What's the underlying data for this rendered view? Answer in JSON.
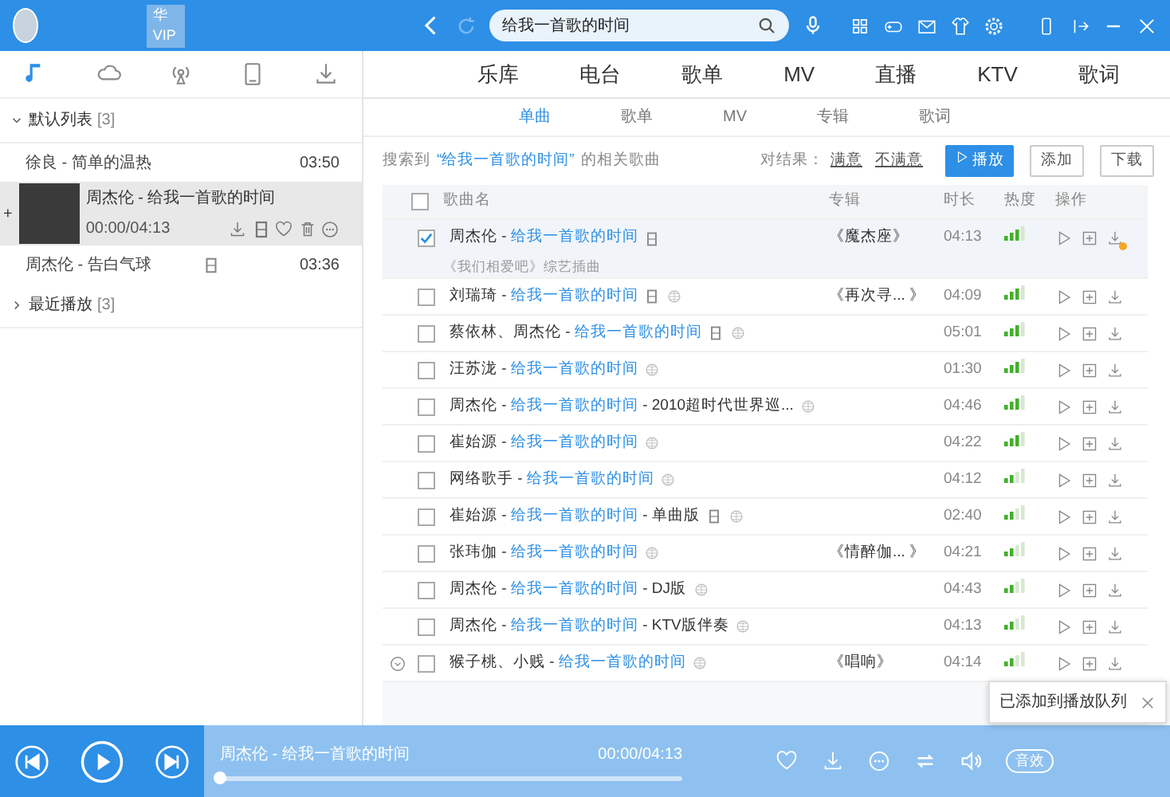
{
  "top_bar": {
    "username": "华VIP",
    "search": {
      "value": "给我一首歌的时间"
    }
  },
  "sidebar": {
    "tabs": [
      {
        "selected": true
      },
      {
        "selected": false
      },
      {
        "selected": false
      },
      {
        "selected": false
      },
      {
        "selected": false
      }
    ],
    "groups": [
      {
        "title": "默认列表",
        "count": "[3]",
        "expanded": true,
        "items": [
          {
            "kind": "song",
            "title": "徐良 - 简单的温热",
            "duration": "03:50",
            "mv": false
          },
          {
            "kind": "playing",
            "title": "周杰伦 - 给我一首歌的时间",
            "time": "00:00/04:13",
            "plus": "+"
          },
          {
            "kind": "song",
            "title": "周杰伦 - 告白气球",
            "duration": "03:36",
            "mv": true
          }
        ]
      },
      {
        "title": "最近播放",
        "count": "[3]",
        "expanded": false
      }
    ]
  },
  "nav_tabs": [
    {
      "label": "乐库",
      "selected": false
    },
    {
      "label": "电台",
      "selected": false
    },
    {
      "label": "歌单",
      "selected": false
    },
    {
      "label": "MV",
      "selected": false
    },
    {
      "label": "直播",
      "selected": false
    },
    {
      "label": "KTV",
      "selected": false
    },
    {
      "label": "歌词",
      "selected": false
    }
  ],
  "sub_tabs": [
    {
      "label": "单曲",
      "selected": true
    },
    {
      "label": "歌单",
      "selected": false
    },
    {
      "label": "MV",
      "selected": false
    },
    {
      "label": "专辑",
      "selected": false
    },
    {
      "label": "歌词",
      "selected": false
    }
  ],
  "result_bar": {
    "prefix": "搜索到",
    "query": "“给我一首歌的时间”",
    "suffix": "的相关歌曲",
    "feedback_label": "对结果：",
    "satisfied": "满意",
    "unsatisfied": "不满意",
    "buttons": [
      {
        "kind": "primary",
        "label": "播放"
      },
      {
        "kind": "plain",
        "label": "添加"
      },
      {
        "kind": "plain",
        "label": "下载"
      }
    ]
  },
  "table": {
    "columns": [
      "歌曲名",
      "专辑",
      "时长",
      "热度",
      "操作"
    ],
    "all_checked": false,
    "rows": [
      {
        "name": "周杰伦 - *给我一首歌的时间*",
        "note": "《我们相爱吧》综艺插曲",
        "album": "《魔杰座》",
        "duration": "04:13",
        "level": 0.75,
        "checked": true,
        "mv": true,
        "sq": false,
        "expandable": false,
        "download_badge": true
      },
      {
        "name": "刘瑞琦 - *给我一首歌的时间*",
        "album": "《再次寻... 》",
        "duration": "04:09",
        "level": 0.75,
        "checked": false,
        "mv": true,
        "sq": true,
        "expandable": false,
        "download_badge": false
      },
      {
        "name": "蔡依林、周杰伦 - *给我一首歌的时间*",
        "duration": "05:01",
        "level": 0.75,
        "checked": false,
        "mv": true,
        "sq": true,
        "expandable": false,
        "download_badge": false
      },
      {
        "name": "汪苏泷 - *给我一首歌的时间*",
        "duration": "01:30",
        "level": 0.75,
        "checked": false,
        "mv": false,
        "sq": true,
        "expandable": false,
        "download_badge": false
      },
      {
        "name": "周杰伦 - *给我一首歌的时间* - 2010超时代世界巡...",
        "duration": "04:46",
        "level": 0.75,
        "checked": false,
        "mv": false,
        "sq": true,
        "expandable": false,
        "download_badge": false
      },
      {
        "name": "崔始源 - *给我一首歌的时间*",
        "duration": "04:22",
        "level": 0.75,
        "checked": false,
        "mv": false,
        "sq": true,
        "expandable": false,
        "download_badge": false
      },
      {
        "name": "网络歌手 - *给我一首歌的时间*",
        "duration": "04:12",
        "level": 0.5,
        "checked": false,
        "mv": false,
        "sq": true,
        "expandable": false,
        "download_badge": false
      },
      {
        "name": "崔始源 - *给我一首歌的时间* - 单曲版",
        "duration": "02:40",
        "level": 0.5,
        "checked": false,
        "mv": true,
        "sq": true,
        "expandable": false,
        "download_badge": false
      },
      {
        "name": "张玮伽 - *给我一首歌的时间*",
        "album": "《情醉伽... 》",
        "duration": "04:21",
        "level": 0.5,
        "checked": false,
        "mv": false,
        "sq": true,
        "expandable": false,
        "download_badge": false
      },
      {
        "name": "周杰伦 - *给我一首歌的时间* - DJ版",
        "duration": "04:43",
        "level": 0.5,
        "checked": false,
        "mv": false,
        "sq": true,
        "expandable": false,
        "download_badge": false
      },
      {
        "name": "周杰伦 - *给我一首歌的时间* - KTV版伴奏",
        "duration": "04:13",
        "level": 0.5,
        "checked": false,
        "mv": false,
        "sq": true,
        "expandable": false,
        "download_badge": false
      },
      {
        "name": "猴子桃、小贱 - *给我一首歌的时间*",
        "album": "《唱响》",
        "duration": "04:14",
        "level": 0.5,
        "checked": false,
        "mv": false,
        "sq": true,
        "expandable": true,
        "download_badge": false
      }
    ]
  },
  "toast": {
    "message": "已添加到播放队列"
  },
  "player": {
    "track": "周杰伦 - 给我一首歌的时间",
    "time": "00:00/04:13",
    "level": 0,
    "effect_label": "音效"
  }
}
